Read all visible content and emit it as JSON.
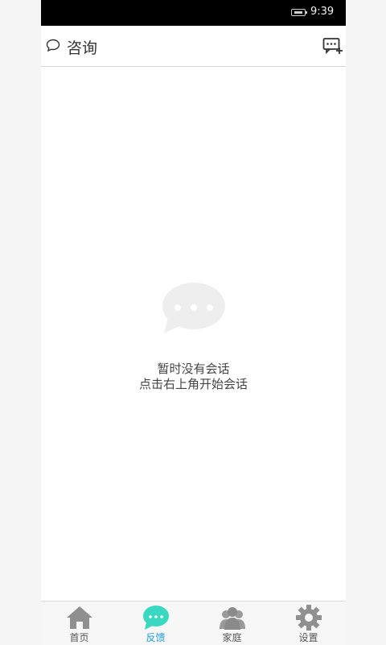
{
  "status_bar": {
    "time": "9:39"
  },
  "header": {
    "title": "咨询",
    "title_icon": "chat-bubble-outline-icon",
    "action_icon": "new-message-icon"
  },
  "empty_state": {
    "icon": "chat-bubble-ellipsis-icon",
    "line1": "暂时没有会话",
    "line2": "点击右上角开始会话"
  },
  "tabs": [
    {
      "label": "首页",
      "icon": "home-icon",
      "active": false
    },
    {
      "label": "反馈",
      "icon": "chat-icon",
      "active": true
    },
    {
      "label": "家庭",
      "icon": "family-icon",
      "active": false
    },
    {
      "label": "设置",
      "icon": "gear-icon",
      "active": false
    }
  ],
  "colors": {
    "active_tab_icon": "#3ad8c0",
    "active_tab_label": "#1b9ad6",
    "inactive_icon": "#9a9a9a"
  }
}
